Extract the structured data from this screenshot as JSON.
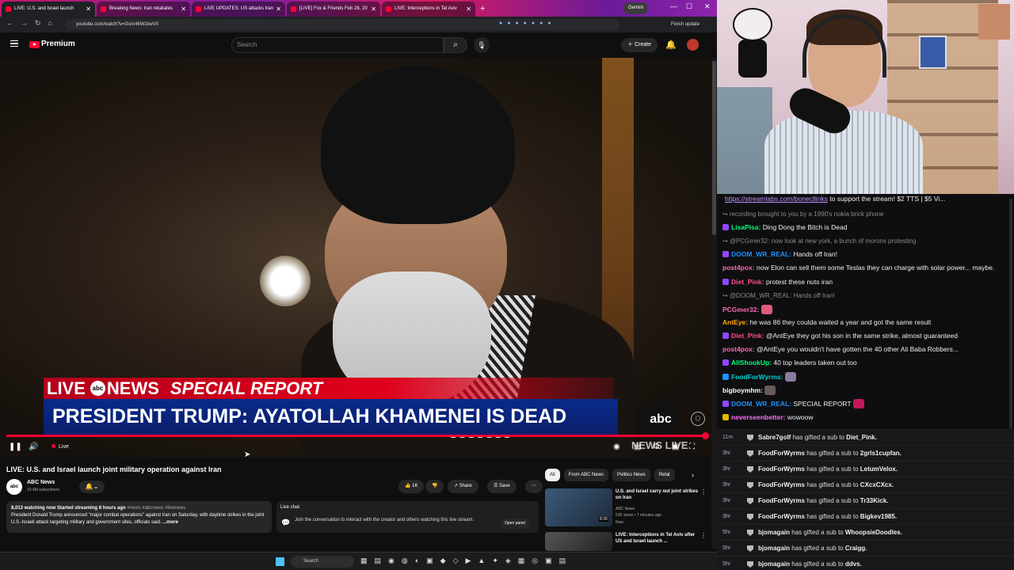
{
  "browser": {
    "tabs": [
      {
        "title": "LIVE: U.S. and Israel launch",
        "active": true
      },
      {
        "title": "Breaking News: Iran retaliates",
        "active": false
      },
      {
        "title": "LIVE UPDATES: US attacks Iran",
        "active": false
      },
      {
        "title": "[LIVE] Fox & Friends Feb 28, 20",
        "active": false
      },
      {
        "title": "LIVE: Interceptions in Tel Aviv",
        "active": false
      }
    ],
    "gemini_label": "Gemini",
    "url": "youtube.com/watch?v=Gsm46WzkwV0",
    "finish_update": "Finish update"
  },
  "youtube": {
    "brand": "Premium",
    "search_placeholder": "Search",
    "create_label": "Create",
    "video": {
      "live_word": "LIVE",
      "abc_small": "abc",
      "news_word": "NEWS",
      "special_report": "SPECIAL REPORT",
      "headline": "PRESIDENT TRUMP: AYATOLLAH KHAMENEI IS DEAD",
      "abc_logo": "abc",
      "news_live": "NEWS LIVE",
      "live_label": "Live",
      "progress": 1.0
    },
    "title": "LIVE: U.S. and Israel launch joint military operation against Iran",
    "channel": {
      "avatar_text": "abc",
      "name": "ABC News",
      "subs": "19.4M subscribers"
    },
    "likes": "1K",
    "share_label": "Share",
    "save_label": "Save",
    "description": {
      "stats": "8,013 watching now  Started streaming 8 hours ago",
      "tags": " #news #abcnews #livenews",
      "text": "President Donald Trump announced \"major combat operations\" against Iran on Saturday, with daytime strikes in the joint U.S.-Israeli attack targeting military and government sites, officials said.",
      "more": " ...more"
    },
    "live_chat": {
      "title": "Live chat",
      "message": "Join the conversation to interact with the creator and others watching this live stream.",
      "open_panel": "Open panel"
    },
    "chips": [
      "All",
      "From ABC News",
      "Politics News",
      "Relat"
    ],
    "recommendations": [
      {
        "title": "U.S. and Israel carry out joint strikes on Iran",
        "channel": "ABC News",
        "meta": "535 views • 7 minutes ago",
        "badge": "New",
        "duration": "8:39"
      },
      {
        "title": "LIVE: Interceptions in Tel Aviv after US and Israel launch ...",
        "channel": "",
        "meta": "",
        "badge": "",
        "duration": ""
      }
    ],
    "taskbar_search": "Search"
  },
  "stream_chat": {
    "top_link_url": "https://streamlabs.com/bonecllinks",
    "top_link_text": " to support the stream! $2 TTS | $5 Vi...",
    "messages": [
      {
        "user": "",
        "text": "recording brought to you by a 1990's nokia brick phone",
        "color": "#8a8a8a",
        "dim": true
      },
      {
        "user": "LisaPisa:",
        "text": " Ding Dong the Bitch is Dead",
        "color": "#00ff7f",
        "badge": "#9147ff"
      },
      {
        "user": "",
        "text": "@PCGmer32: now look at new york, a bunch of morons protesting",
        "color": "#8a8a8a",
        "dim": true
      },
      {
        "user": "DOOM_WR_REAL:",
        "text": " Hands off Iran!",
        "color": "#1e90ff",
        "badge": "#9147ff"
      },
      {
        "user": "post4pox:",
        "text": " now Elon can sell them some Teslas they can charge with solar power... maybe.",
        "color": "#ff69b4",
        "badge": ""
      },
      {
        "user": "Diet_Pink:",
        "text": " protest these nuts iran",
        "color": "#ff4f8b",
        "badge": "#9147ff"
      },
      {
        "user": "",
        "text": "@DOOM_WR_REAL: Hands off Iran!",
        "color": "#8a8a8a",
        "dim": true
      },
      {
        "user": "PCGmer32:",
        "text": " ",
        "color": "#ff69b4",
        "badge": "",
        "emote": "#e05a7a"
      },
      {
        "user": "AntEye:",
        "text": " he was 86 they coulda waited a year and got the same result",
        "color": "#ffa500",
        "badge": ""
      },
      {
        "user": "Diet_Pink:",
        "text": " @AntEye they got his son in the same strike, almost guaranteed",
        "color": "#ff4f8b",
        "badge": "#9147ff"
      },
      {
        "user": "post4pox:",
        "text": " @AntEye you wouldn't have gotten the 40 other Ali Baba Robbers...",
        "color": "#ff69b4",
        "badge": ""
      },
      {
        "user": "AllShookUp:",
        "text": " 40 top leaders taken out too",
        "color": "#00ff7f",
        "badge": "#9147ff"
      },
      {
        "user": "FoodForWyrms:",
        "text": " ",
        "color": "#00d0d0",
        "badge": "#1e90ff",
        "emote": "#8a7aa0"
      },
      {
        "user": "bigboymhm:",
        "text": " ",
        "color": "#ffffff",
        "badge": "",
        "emote": "#6a5a5a"
      },
      {
        "user": "DOOM_WR_REAL:",
        "text": " SPECIAL REPORT ",
        "color": "#1e90ff",
        "badge": "#9147ff",
        "emote": "#c2185b"
      },
      {
        "user": "neverseenbetter:",
        "text": " wowoow",
        "color": "#ff6fff",
        "badge": "#e6b800"
      }
    ],
    "subs": [
      {
        "time": "11m",
        "gifter": "Sabre7golf",
        "recipient": "Diet_Pink."
      },
      {
        "time": "3hr",
        "gifter": "FoodForWyrms",
        "recipient": "2grls1cupfan."
      },
      {
        "time": "3hr",
        "gifter": "FoodForWyrms",
        "recipient": "LetumVelox."
      },
      {
        "time": "3hr",
        "gifter": "FoodForWyrms",
        "recipient": "CXcxCXcx."
      },
      {
        "time": "3hr",
        "gifter": "FoodForWyrms",
        "recipient": "Tr33Kick."
      },
      {
        "time": "3hr",
        "gifter": "FoodForWyrms",
        "recipient": "Bigkev1985."
      },
      {
        "time": "5hr",
        "gifter": "bjomagain",
        "recipient": "WhoopsieDoodles."
      },
      {
        "time": "5hr",
        "gifter": "bjomagain",
        "recipient": "Craigg."
      },
      {
        "time": "5hr",
        "gifter": "bjomagain",
        "recipient": "ddvs."
      }
    ],
    "sub_middle_text": " has gifted a sub to "
  }
}
